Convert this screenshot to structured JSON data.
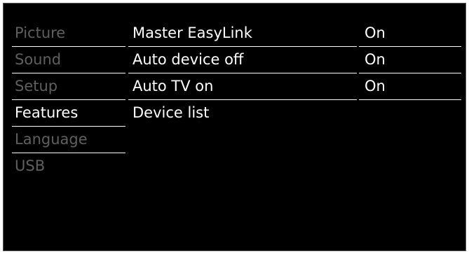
{
  "menu": {
    "items": [
      {
        "label": "Picture",
        "active": false
      },
      {
        "label": "Sound",
        "active": false
      },
      {
        "label": "Setup",
        "active": false
      },
      {
        "label": "Features",
        "active": true
      },
      {
        "label": "Language",
        "active": false
      },
      {
        "label": "USB",
        "active": false
      }
    ]
  },
  "submenu": {
    "items": [
      {
        "label": "Master EasyLink",
        "value": "On"
      },
      {
        "label": "Auto device off",
        "value": "On"
      },
      {
        "label": "Auto TV on",
        "value": "On"
      },
      {
        "label": "Device list",
        "value": ""
      }
    ]
  },
  "colors": {
    "background": "#000000",
    "text_active": "#ffffff",
    "text_inactive": "#5f5f5f",
    "divider": "#ffffff"
  }
}
